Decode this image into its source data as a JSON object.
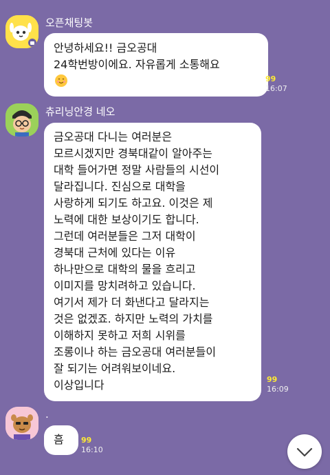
{
  "messages": [
    {
      "sender": "오픈채팅봇",
      "lines": [
        "안녕하세요!! 금오공대",
        "24학번방이에요. 자유롭게 소통해요"
      ],
      "emoji": "smiling-face-emoji",
      "unread": "99",
      "time": "16:07"
    },
    {
      "sender": "츄리닝안경 네오",
      "lines": [
        "금오공대 다니는 여러분은",
        "모르시겠지만 경북대같이 알아주는",
        "대학 들어가면 정말 사람들의 시선이",
        "달라집니다. 진심으로 대학을",
        "사랑하게 되기도 하고요. 이것은 제",
        "노력에 대한 보상이기도 합니다.",
        "그런데 여러분들은 그저 대학이",
        "경북대 근처에 있다는 이유",
        "하나만으로 대학의 물을 흐리고",
        "이미지를 망치려하고 있습니다.",
        "여기서 제가 더 화낸다고 달라지는",
        "것은 없겠죠. 하지만 노력의 가치를",
        "이해하지 못하고 저희 시위를",
        "조롱이나 하는 금오공대 여러분들이",
        "잘 되기는 어려워보이네요.",
        "이상입니다"
      ],
      "unread": "99",
      "time": "16:09"
    },
    {
      "sender": ".",
      "lines": [
        "흠"
      ],
      "unread": "99",
      "time": "16:10"
    }
  ],
  "icons": {
    "avatar1": "chatbot-avatar-icon",
    "avatar2": "neo-character-avatar-icon",
    "avatar3": "character-avatar-icon",
    "scroll": "chevron-down-icon"
  },
  "colors": {
    "background": "#7b6aa6",
    "bubble": "#ffffff",
    "unread": "#ffeb33"
  }
}
